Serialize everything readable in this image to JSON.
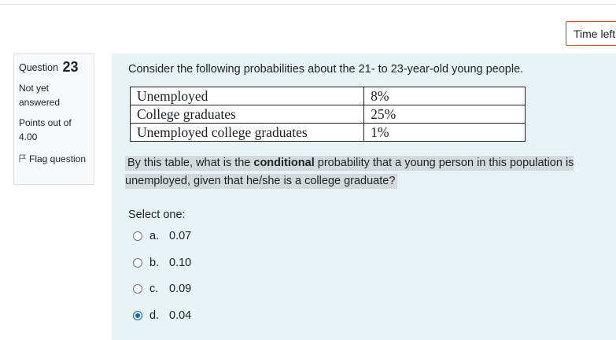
{
  "timer": {
    "label": "Time left"
  },
  "info": {
    "question_prefix": "Question",
    "question_number": "23",
    "state": "Not yet answered",
    "grade": "Points out of 4.00",
    "flag_label": "Flag question"
  },
  "question": {
    "intro": "Consider the following probabilities about the 21- to 23-year-old young people.",
    "table": [
      {
        "label": "Unemployed",
        "value": "8%"
      },
      {
        "label": "College graduates",
        "value": "25%"
      },
      {
        "label": "Unemployed college graduates",
        "value": "1%"
      }
    ],
    "ask_pre": "By this table, what is the ",
    "ask_bold": "conditional",
    "ask_post": " probability that a young person in this population is unemployed, given that he/she is a college graduate?",
    "prompt": "Select one:",
    "answers": [
      {
        "letter": "a.",
        "text": "0.07",
        "selected": false
      },
      {
        "letter": "b.",
        "text": "0.10",
        "selected": false
      },
      {
        "letter": "c.",
        "text": "0.09",
        "selected": false
      },
      {
        "letter": "d.",
        "text": "0.04",
        "selected": true
      }
    ]
  },
  "colors": {
    "accent": "#0f6cbf",
    "content_bg": "#e7f3f5",
    "timer_border": "#ca3120"
  }
}
